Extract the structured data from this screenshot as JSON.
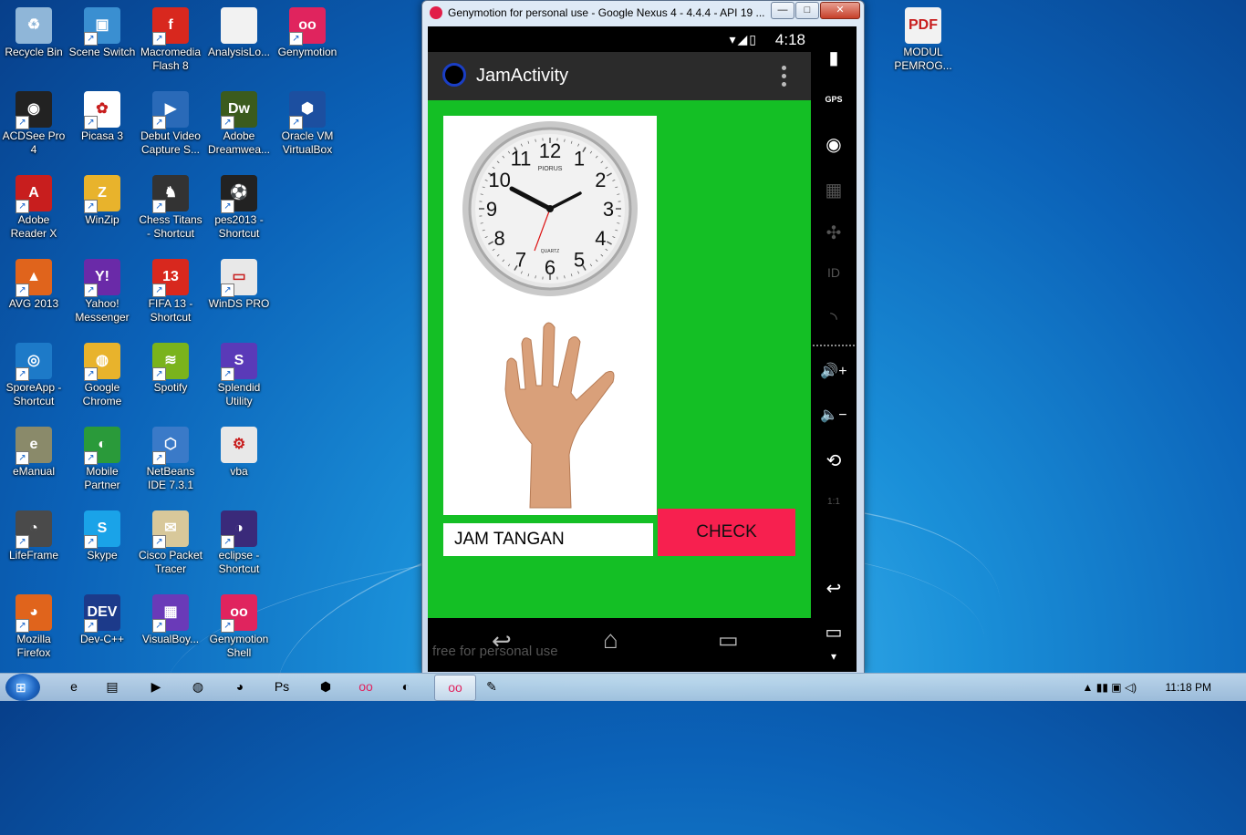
{
  "desktop": {
    "icons": [
      {
        "label": "Recycle Bin",
        "icon": "recycle-bin-icon",
        "color": "#8fb6d8",
        "glyph": "♻"
      },
      {
        "label": "Scene Switch",
        "icon": "scene-switch-icon",
        "color": "#3a8fd1",
        "glyph": "▣"
      },
      {
        "label": "Macromedia Flash 8",
        "icon": "flash-icon",
        "color": "#d8281e",
        "glyph": "f"
      },
      {
        "label": "AnalysisLo...",
        "icon": "document-icon",
        "color": "#f2f2f2",
        "glyph": ""
      },
      {
        "label": "Genymotion",
        "icon": "genymotion-icon",
        "color": "#e0245e",
        "glyph": "oo"
      },
      {
        "label": "ACDSee Pro 4",
        "icon": "camera-icon",
        "color": "#222",
        "glyph": "◉"
      },
      {
        "label": "Picasa 3",
        "icon": "picasa-icon",
        "color": "#ffffff",
        "glyph": "✿"
      },
      {
        "label": "Debut Video Capture S...",
        "icon": "video-capture-icon",
        "color": "#2a6ab8",
        "glyph": "▶"
      },
      {
        "label": "Adobe Dreamwea...",
        "icon": "dreamweaver-icon",
        "color": "#3b5b1d",
        "glyph": "Dw"
      },
      {
        "label": "Oracle VM VirtualBox",
        "icon": "virtualbox-icon",
        "color": "#1c4fa0",
        "glyph": "⬢"
      },
      {
        "label": "Adobe Reader X",
        "icon": "adobe-reader-icon",
        "color": "#c81e1e",
        "glyph": "A"
      },
      {
        "label": "WinZip",
        "icon": "winzip-icon",
        "color": "#e8b32c",
        "glyph": "Z"
      },
      {
        "label": "Chess Titans - Shortcut",
        "icon": "chess-icon",
        "color": "#333",
        "glyph": "♞"
      },
      {
        "label": "pes2013 - Shortcut",
        "icon": "pes-icon",
        "color": "#222",
        "glyph": "⚽"
      },
      {
        "label": "AVG 2013",
        "icon": "avg-icon",
        "color": "#e0641c",
        "glyph": "▲"
      },
      {
        "label": "Yahoo! Messenger",
        "icon": "yahoo-icon",
        "color": "#6a2aa8",
        "glyph": "Y!"
      },
      {
        "label": "FIFA 13 - Shortcut",
        "icon": "fifa-icon",
        "color": "#d8281e",
        "glyph": "13"
      },
      {
        "label": "WinDS PRO",
        "icon": "nintendo-ds-icon",
        "color": "#e8e8e8",
        "glyph": "▭"
      },
      {
        "label": "SporeApp - Shortcut",
        "icon": "spore-icon",
        "color": "#1d7ac8",
        "glyph": "◎"
      },
      {
        "label": "Google Chrome",
        "icon": "chrome-icon",
        "color": "#e8b32c",
        "glyph": "◍"
      },
      {
        "label": "Spotify",
        "icon": "spotify-icon",
        "color": "#7ab31c",
        "glyph": "≋"
      },
      {
        "label": "Splendid Utility",
        "icon": "splendid-icon",
        "color": "#5a3ab8",
        "glyph": "S"
      },
      {
        "label": "eManual",
        "icon": "emanual-icon",
        "color": "#8a8a6a",
        "glyph": "e"
      },
      {
        "label": "Mobile Partner",
        "icon": "mobile-partner-icon",
        "color": "#2a9a3a",
        "glyph": "◐"
      },
      {
        "label": "NetBeans IDE 7.3.1",
        "icon": "netbeans-icon",
        "color": "#3a7ac8",
        "glyph": "⬡"
      },
      {
        "label": "vba",
        "icon": "vba-file-icon",
        "color": "#e8e8e8",
        "glyph": "⚙"
      },
      {
        "label": "LifeFrame",
        "icon": "lifeframe-icon",
        "color": "#4a4a4a",
        "glyph": "◔"
      },
      {
        "label": "Skype",
        "icon": "skype-icon",
        "color": "#1aa3e8",
        "glyph": "S"
      },
      {
        "label": "Cisco Packet Tracer",
        "icon": "cisco-icon",
        "color": "#d8c89a",
        "glyph": "✉"
      },
      {
        "label": "eclipse - Shortcut",
        "icon": "eclipse-icon",
        "color": "#3a2a7a",
        "glyph": "◑"
      },
      {
        "label": "Mozilla Firefox",
        "icon": "firefox-icon",
        "color": "#e0641c",
        "glyph": "◕"
      },
      {
        "label": "Dev-C++",
        "icon": "dev-cpp-icon",
        "color": "#1c3a8a",
        "glyph": "DEV"
      },
      {
        "label": "VisualBoy...",
        "icon": "visualboy-icon",
        "color": "#6a3ab8",
        "glyph": "▦"
      },
      {
        "label": "Genymotion Shell",
        "icon": "genymotion-shell-icon",
        "color": "#e0245e",
        "glyph": "oo"
      },
      {
        "label": "MODUL PEMROG...",
        "icon": "pdf-icon",
        "color": "#f2f2f2",
        "glyph": "PDF"
      }
    ]
  },
  "window": {
    "title": "Genymotion for personal use - Google Nexus 4 - 4.4.4 - API 19 ...",
    "minimize": "—",
    "maximize": "□",
    "close": "✕"
  },
  "device": {
    "status_time": "4:18",
    "status_icons": "▾◢▯",
    "app_title": "JamActivity",
    "overflow": "⋮",
    "input_value": "JAM TANGAN",
    "check_label": "CHECK",
    "nav_back": "↩",
    "nav_home": "⌂",
    "nav_recent": "▭",
    "watermark": "free for personal use"
  },
  "clock": {
    "brand": "PIORUS",
    "quartz": "QUARTZ",
    "numbers": [
      "12",
      "1",
      "2",
      "3",
      "4",
      "5",
      "6",
      "7",
      "8",
      "9",
      "10",
      "11"
    ]
  },
  "sidebar": {
    "battery": "▮",
    "gps": "GPS",
    "camera": "◉",
    "media": "▦",
    "dpad": "✣",
    "id": "ID",
    "rss": "◝",
    "vol_up": "🔊+",
    "vol_down": "🔈−",
    "rotate": "⟲",
    "ratio": "1:1",
    "back": "↩",
    "recent": "▭",
    "more": "▾"
  },
  "taskbar": {
    "start": "⊞",
    "items": [
      {
        "name": "ie",
        "glyph": "e",
        "active": false
      },
      {
        "name": "explorer",
        "glyph": "▤",
        "active": false
      },
      {
        "name": "media-player",
        "glyph": "▶",
        "active": false
      },
      {
        "name": "chrome",
        "glyph": "◍",
        "active": false
      },
      {
        "name": "firefox",
        "glyph": "◕",
        "active": false
      },
      {
        "name": "photoshop",
        "glyph": "Ps",
        "active": false
      },
      {
        "name": "virtualbox",
        "glyph": "⬢",
        "active": false
      },
      {
        "name": "genymotion",
        "glyph": "oo",
        "active": false
      },
      {
        "name": "android-tool",
        "glyph": "◐",
        "active": false
      },
      {
        "name": "genymotion-device",
        "glyph": "oo",
        "active": true
      },
      {
        "name": "paint",
        "glyph": "✎",
        "active": false
      }
    ],
    "tray_icons": "▲ ▮▮ ▣ ◁)",
    "clock": "11:18 PM"
  }
}
